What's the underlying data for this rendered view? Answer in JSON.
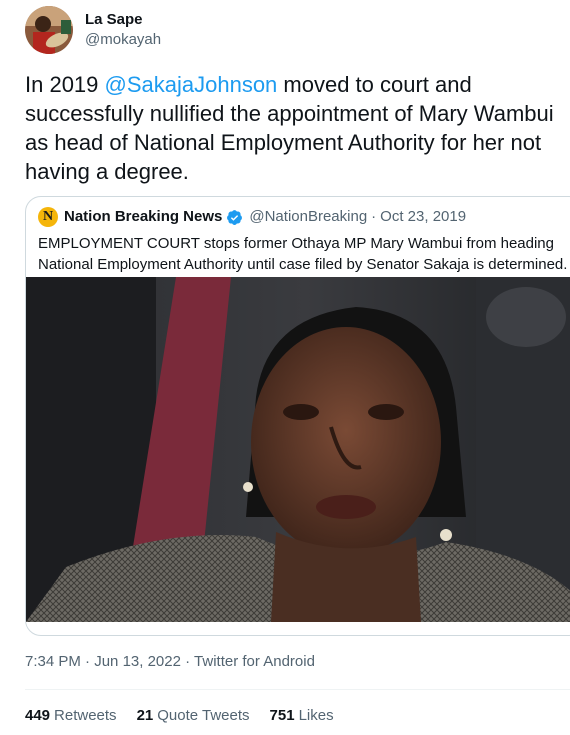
{
  "author": {
    "display_name": "La Sape",
    "handle": "@mokayah"
  },
  "tweet": {
    "line1_pre": "In 2019 ",
    "mention": "@SakajaJohnson",
    "line1_post": " moved to court and",
    "line2": "successfully nullified the appointment of Mary Wambui",
    "line3": "as head of National Employment Authority for her not",
    "line4": "having  a degree."
  },
  "quoted_tweet": {
    "logo_letter": "N",
    "name": "Nation Breaking News",
    "handle": "@NationBreaking",
    "separator": "·",
    "date": "Oct 23, 2019",
    "text_line1": "EMPLOYMENT COURT stops former Othaya MP Mary Wambui from heading",
    "text_line2": "National Employment Authority until case filed by Senator Sakaja is determined."
  },
  "meta": {
    "time": "7:34 PM",
    "date": "Jun 13, 2022",
    "source": "Twitter for Android",
    "separator": "·"
  },
  "stats": {
    "retweets_count": "449",
    "retweets_label": "Retweets",
    "quotes_count": "21",
    "quotes_label": "Quote Tweets",
    "likes_count": "751",
    "likes_label": "Likes"
  },
  "colors": {
    "link": "#1d9bf0",
    "secondary_text": "#536471",
    "verified": "#1d9bf0"
  }
}
